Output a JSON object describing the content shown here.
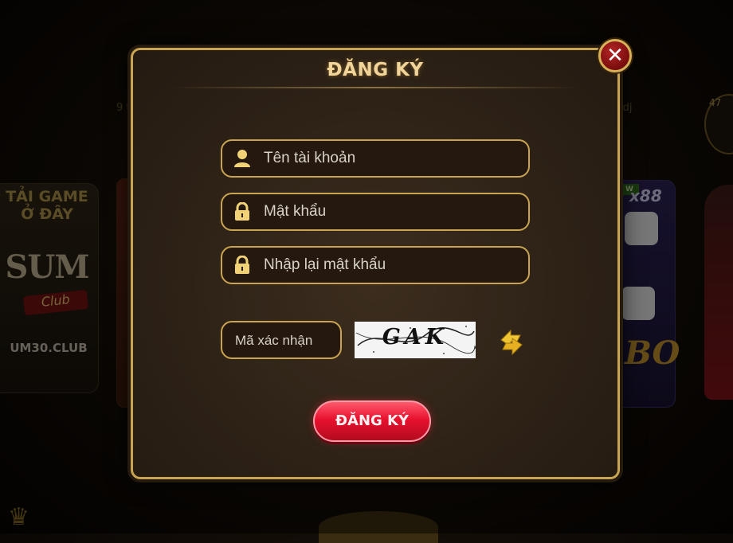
{
  "dialog": {
    "title": "ĐĂNG KÝ",
    "close_icon": "close-icon",
    "username_placeholder": "Tên tài khoản",
    "password_placeholder": "Mật khẩu",
    "confirm_password_placeholder": "Nhập lại mật khẩu",
    "captcha_placeholder": "Mã xác nhận",
    "captcha_text": "GAK",
    "refresh_icon": "refresh-icon",
    "submit_label": "ĐĂNG KÝ"
  },
  "background": {
    "left_text": "9 t",
    "right_text": "jdj",
    "sum_title": "TẢI GAME Ở ĐÂY",
    "sum_logo": "SUM",
    "sum_club": "Club",
    "sum_domain": "UM30.CLUB",
    "x88_label": "x88",
    "new_label": "W",
    "bo_label": "BO",
    "badge_number": "47"
  },
  "colors": {
    "gold": "#c9a452",
    "title": "#f1d49a",
    "button_red": "#e8112e"
  }
}
